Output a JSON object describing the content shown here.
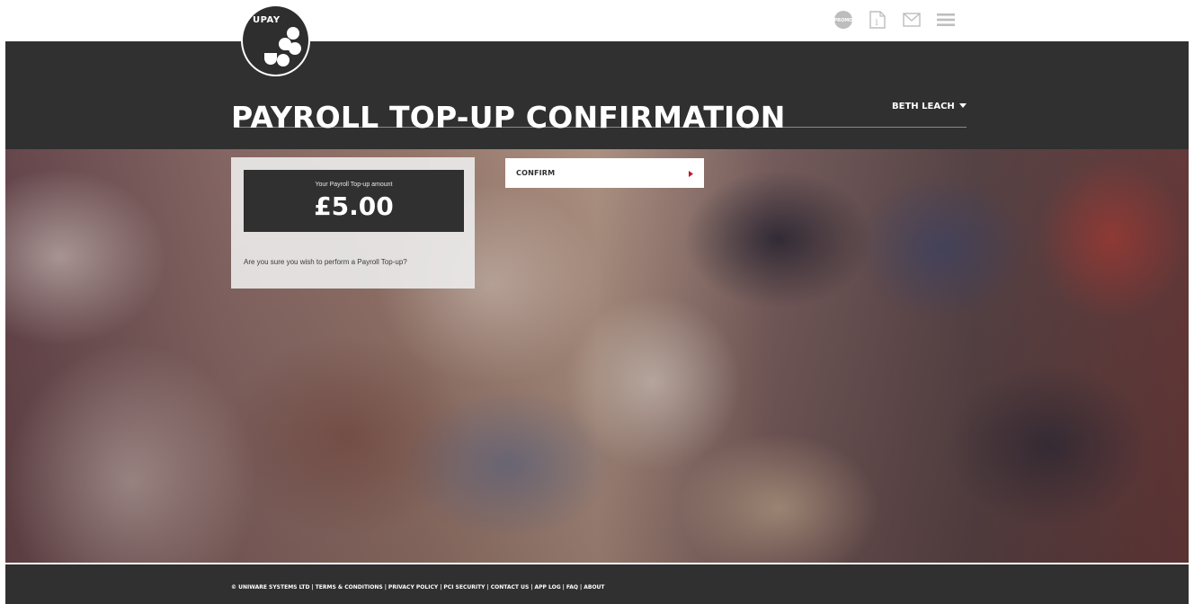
{
  "brand": {
    "logo_text": "UPAY"
  },
  "top_icons": [
    {
      "name": "promo-icon",
      "label": "PROMO"
    },
    {
      "name": "info-icon",
      "label": "i"
    },
    {
      "name": "mail-icon",
      "label": ""
    },
    {
      "name": "menu-icon",
      "label": ""
    }
  ],
  "user": {
    "name": "BETH LEACH"
  },
  "page": {
    "title": "PAYROLL TOP-UP CONFIRMATION"
  },
  "card": {
    "amount_label": "Your Payroll Top-up amount",
    "amount_value": "£5.00",
    "question": "Are you sure you wish to perform a Payroll Top-up?"
  },
  "confirm": {
    "label": "CONFIRM"
  },
  "footer": {
    "copyright": "© UNIWARE SYSTEMS LTD",
    "links": [
      "TERMS & CONDITIONS",
      "PRIVACY POLICY",
      "PCI SECURITY",
      "CONTACT US",
      "APP LOG",
      "FAQ",
      "ABOUT"
    ]
  },
  "colors": {
    "dark": "#303030",
    "accent": "#c0182a"
  }
}
